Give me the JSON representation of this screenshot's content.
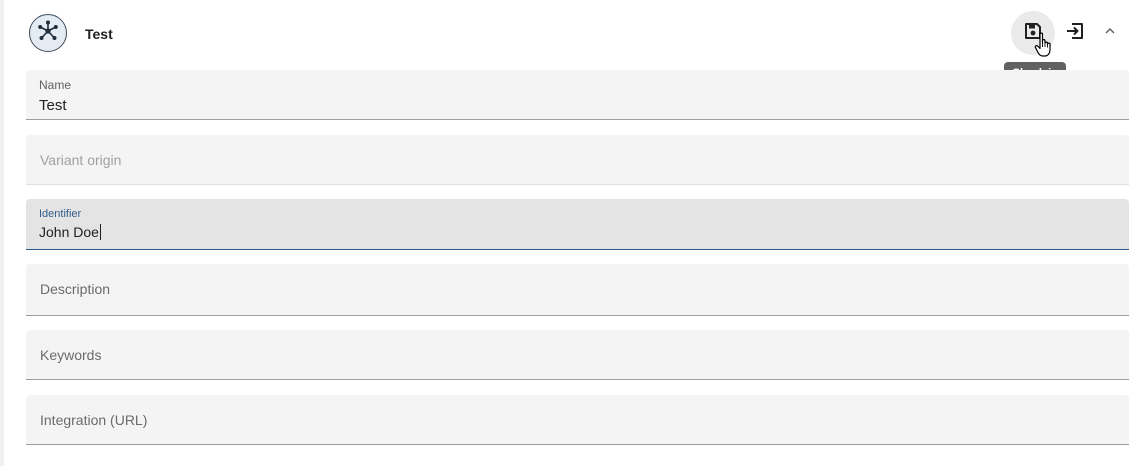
{
  "header": {
    "title": "Test",
    "avatar_icon": "network-hub-icon",
    "actions": {
      "save_icon": "save-icon",
      "checkin_icon": "login-icon",
      "collapse_icon": "chevron-up-icon"
    },
    "tooltip": "Check in"
  },
  "form": {
    "name": {
      "label": "Name",
      "value": "Test"
    },
    "variant_origin": {
      "placeholder": "Variant origin"
    },
    "identifier": {
      "label": "Identifier",
      "value": "John Doe"
    },
    "description": {
      "placeholder": "Description"
    },
    "keywords": {
      "placeholder": "Keywords"
    },
    "integration": {
      "placeholder": "Integration (URL)"
    }
  },
  "colors": {
    "accent": "#2e5c8a",
    "field_bg": "#f4f4f4",
    "focused_bg": "#e4e4e4",
    "tooltip_bg": "#616161"
  }
}
